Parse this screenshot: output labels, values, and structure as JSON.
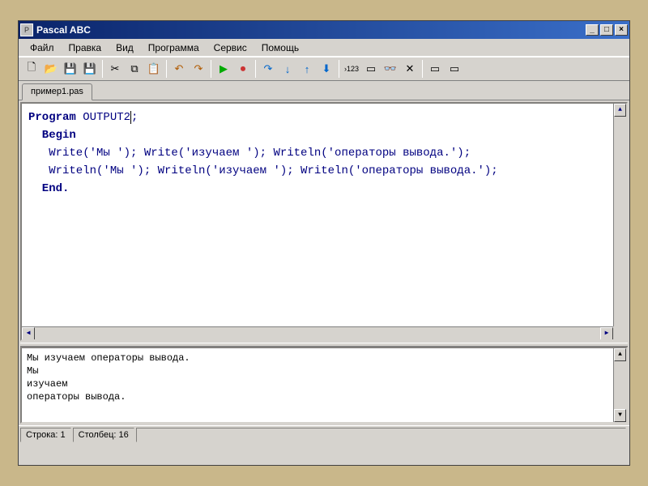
{
  "window": {
    "title": "Pascal ABC"
  },
  "menus": [
    "Файл",
    "Правка",
    "Вид",
    "Программа",
    "Сервис",
    "Помощь"
  ],
  "toolbar_icons": [
    "new",
    "open",
    "save",
    "save-all",
    "cut",
    "copy",
    "paste",
    "undo",
    "redo",
    "run",
    "stop",
    "step-over",
    "step-into",
    "step-out",
    "breakpoint",
    "goto",
    "watch",
    "debug",
    "close",
    "w1",
    "w2"
  ],
  "tab": {
    "label": "пример1.pas"
  },
  "code": {
    "l1a": "Program ",
    "l1b": "OUTPUT2",
    "l1c": ";",
    "l2": "",
    "l3": "  Begin",
    "l4": "   Write('Мы '); Write('изучаем '); Writeln('операторы вывода.');",
    "l5": "   Writeln('Мы '); Writeln('изучаем '); Writeln('операторы вывода.');",
    "l6": "  End."
  },
  "output": {
    "o1": "Мы изучаем операторы вывода.",
    "o2": "Мы",
    "o3": "изучаем",
    "o4": "операторы вывода."
  },
  "status": {
    "line_label": "Строка: 1",
    "col_label": "Столбец: 16"
  }
}
